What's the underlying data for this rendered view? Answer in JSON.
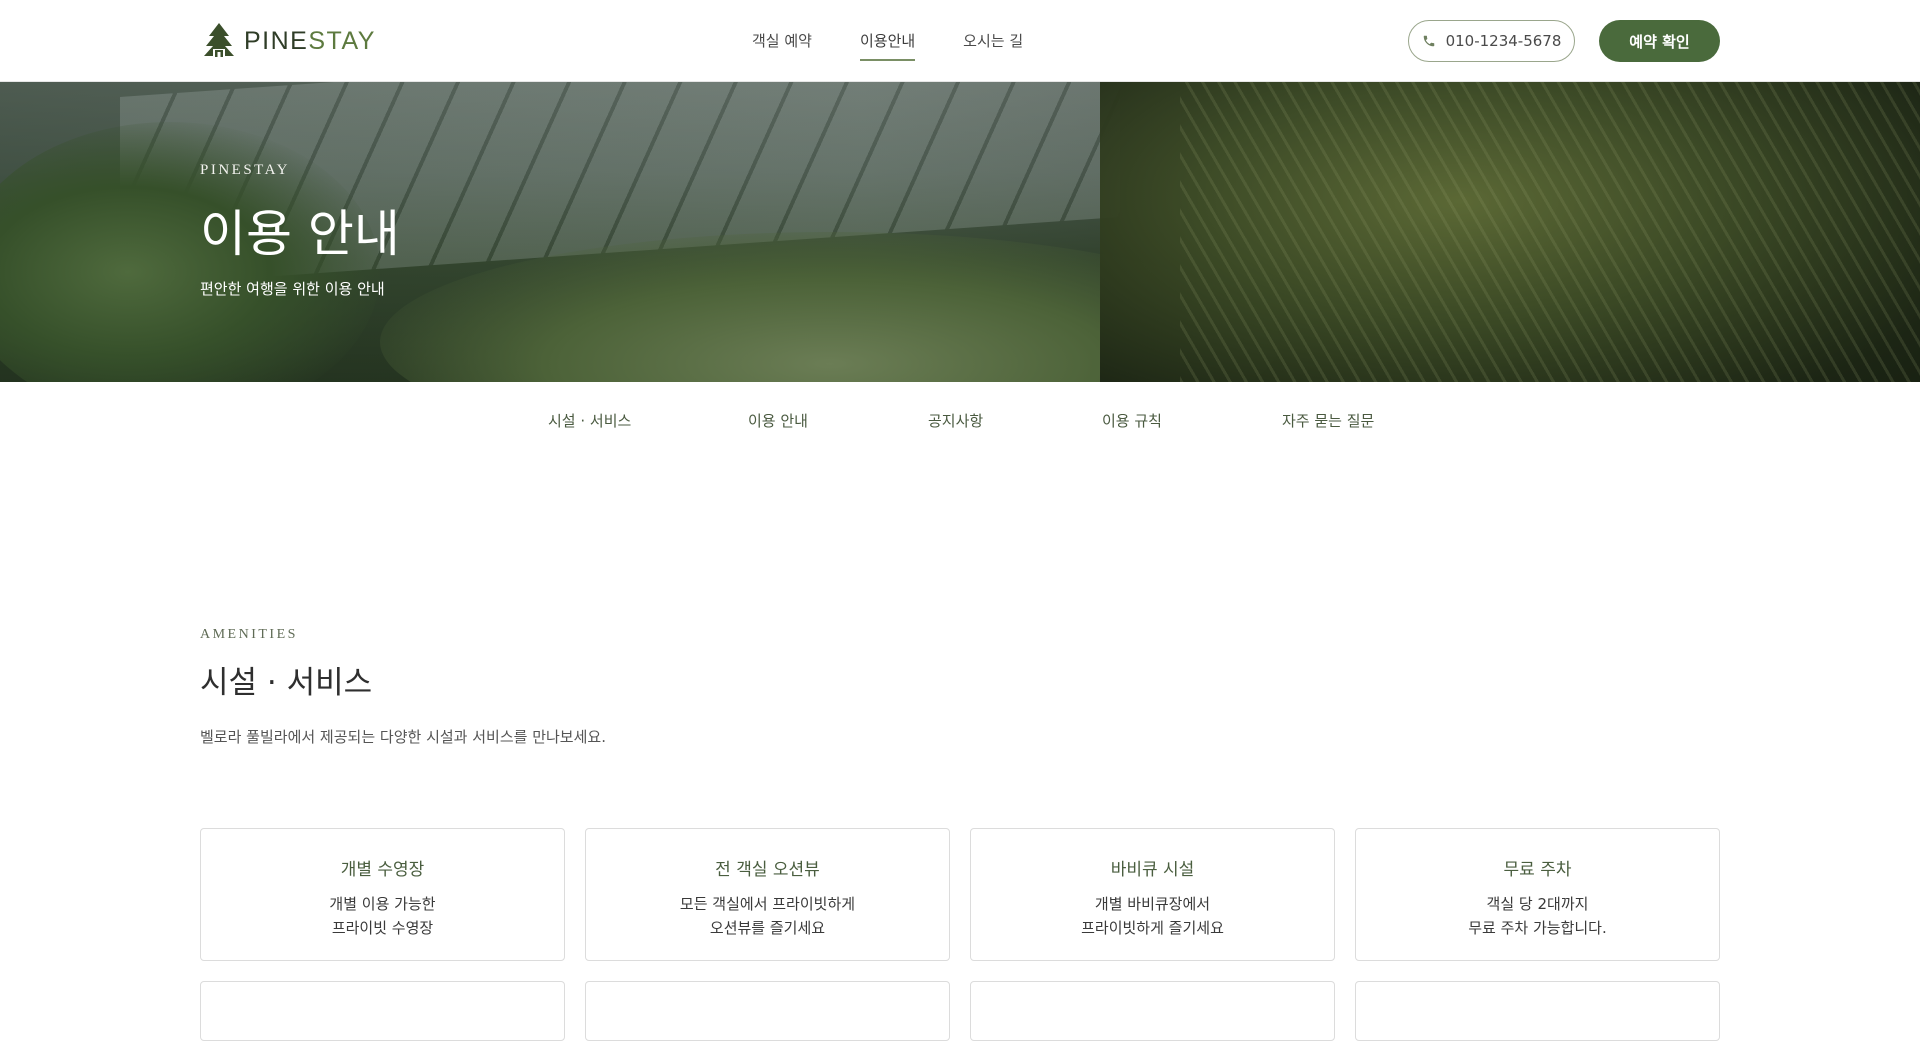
{
  "header": {
    "logo": {
      "part1": "PINE",
      "part2": "STAY"
    },
    "nav": [
      {
        "label": "객실 예약"
      },
      {
        "label": "이용안내"
      },
      {
        "label": "오시는 길"
      }
    ],
    "phone": "010-1234-5678",
    "reserve_label": "예약 확인"
  },
  "hero": {
    "brand": "PINESTAY",
    "title": "이용 안내",
    "subtitle": "편안한 여행을 위한 이용 안내"
  },
  "subnav": [
    {
      "label": "시설 · 서비스"
    },
    {
      "label": "이용 안내"
    },
    {
      "label": "공지사항"
    },
    {
      "label": "이용 규칙"
    },
    {
      "label": "자주 묻는 질문"
    }
  ],
  "amenities": {
    "eyebrow": "AMENITIES",
    "title": "시설 · 서비스",
    "description": "벨로라 풀빌라에서 제공되는 다양한 시설과 서비스를 만나보세요.",
    "cards": [
      {
        "title": "개별 수영장",
        "desc": "개별 이용 가능한\n프라이빗 수영장"
      },
      {
        "title": "전 객실 오션뷰",
        "desc": "모든 객실에서 프라이빗하게\n오션뷰를 즐기세요"
      },
      {
        "title": "바비큐 시설",
        "desc": "개별 바비큐장에서\n프라이빗하게 즐기세요"
      },
      {
        "title": "무료 주차",
        "desc": "객실 당 2대까지\n무료 주차 가능합니다."
      }
    ]
  },
  "colors": {
    "accent": "#4a6a3c",
    "nav_underline": "#7a8f65"
  }
}
